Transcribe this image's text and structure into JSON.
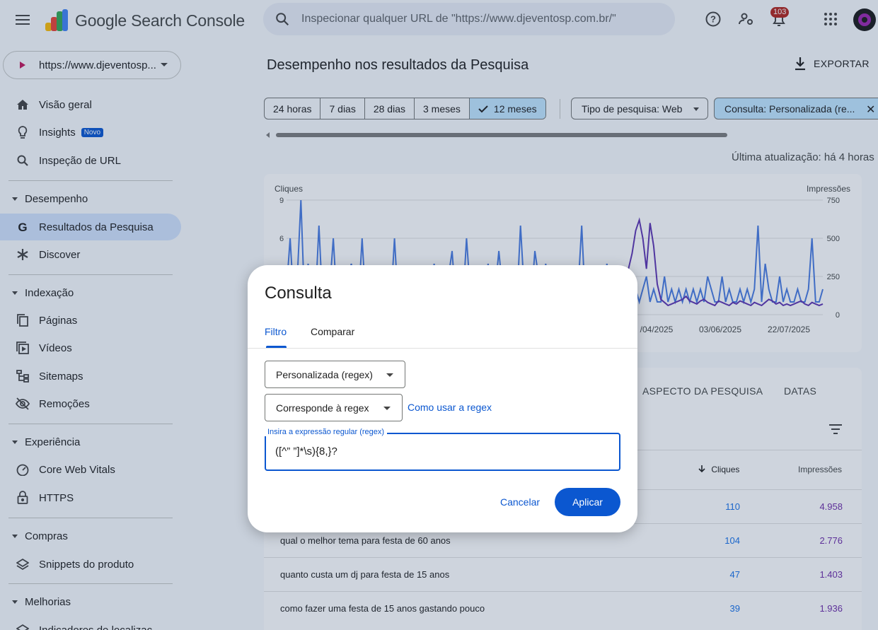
{
  "app": {
    "title": "Google Search Console"
  },
  "search": {
    "placeholder": "Inspecionar qualquer URL de \"https://www.djeventosp.com.br/\""
  },
  "header": {
    "notifications_count": "103"
  },
  "sidebar": {
    "property": "https://www.djeventosp...",
    "items": [
      {
        "label": "Visão geral"
      },
      {
        "label": "Insights",
        "badge": "Novo"
      },
      {
        "label": "Inspeção de URL"
      }
    ],
    "sections": [
      {
        "label": "Desempenho",
        "items": [
          "Resultados da Pesquisa",
          "Discover"
        ]
      },
      {
        "label": "Indexação",
        "items": [
          "Páginas",
          "Vídeos",
          "Sitemaps",
          "Remoções"
        ]
      },
      {
        "label": "Experiência",
        "items": [
          "Core Web Vitals",
          "HTTPS"
        ]
      },
      {
        "label": "Compras",
        "items": [
          "Snippets do produto"
        ]
      },
      {
        "label": "Melhorias",
        "items": [
          "Indicadores de localizac"
        ]
      }
    ]
  },
  "main": {
    "title": "Desempenho nos resultados da Pesquisa",
    "export_label": "EXPORTAR",
    "date_ranges": [
      "24 horas",
      "7 dias",
      "28 dias",
      "3 meses",
      "12 meses"
    ],
    "selected_range": "12 meses",
    "search_type_chip": "Tipo de pesquisa: Web",
    "query_chip": "Consulta: Personalizada (re...",
    "last_updated": "Última atualização: há 4 horas",
    "tabs": [
      "ASPECTO DA PESQUISA",
      "DATAS"
    ],
    "table": {
      "col_clicks": "Cliques",
      "col_impressions": "Impressões",
      "rows": [
        {
          "query": "",
          "clicks": "110",
          "impressions": "4.958"
        },
        {
          "query": "qual o melhor tema para festa de 60 anos",
          "clicks": "104",
          "impressions": "2.776"
        },
        {
          "query": "quanto custa um dj para festa de 15 anos",
          "clicks": "47",
          "impressions": "1.403"
        },
        {
          "query": "como fazer uma festa de 15 anos gastando pouco",
          "clicks": "39",
          "impressions": "1.936"
        }
      ]
    }
  },
  "chart_data": {
    "type": "line",
    "left_axis_label": "Cliques",
    "right_axis_label": "Impressões",
    "left_ticks": [
      "9",
      "6"
    ],
    "right_ticks": [
      "750",
      "500",
      "250",
      "0"
    ],
    "x_ticks": [
      "/04/2025",
      "03/06/2025",
      "22/07/2025"
    ],
    "left_ylim": [
      0,
      9
    ],
    "right_ylim": [
      0,
      750
    ],
    "series": [
      {
        "name": "Cliques",
        "color": "#4a7ce0",
        "values": [
          2,
          6,
          1,
          3,
          9,
          1,
          4,
          2,
          1,
          7,
          1,
          3,
          2,
          6,
          1,
          2,
          1,
          3,
          4,
          2,
          1,
          6,
          1,
          2,
          1,
          2,
          3,
          1,
          2,
          1,
          6,
          1,
          2,
          1,
          2,
          1,
          3,
          2,
          1,
          2,
          1,
          4,
          2,
          1,
          1,
          3,
          5,
          1,
          2,
          1,
          6,
          2,
          1,
          3,
          1,
          2,
          4,
          1,
          2,
          5,
          2,
          1,
          3,
          2,
          1,
          7,
          2,
          3,
          1,
          5,
          3,
          1,
          4,
          2,
          1,
          3,
          1,
          2,
          3,
          1,
          1,
          2,
          7,
          1,
          2,
          1,
          2,
          3,
          1,
          4,
          2,
          1,
          3,
          1,
          2,
          3,
          1,
          2,
          1,
          2,
          3,
          1,
          2,
          1,
          1,
          3,
          1,
          2,
          1,
          2,
          1,
          2,
          1,
          2,
          1,
          2,
          1,
          3,
          2,
          1,
          1,
          3,
          1,
          2,
          1,
          1,
          2,
          1,
          2,
          1,
          2,
          7,
          1,
          4,
          2,
          1,
          1,
          3,
          1,
          2,
          1,
          1,
          2,
          1,
          1,
          2,
          6,
          1,
          1,
          2
        ]
      },
      {
        "name": "Impressões",
        "color": "#5e35b1",
        "values": [
          60,
          70,
          60,
          80,
          70,
          60,
          50,
          70,
          80,
          60,
          70,
          60,
          80,
          70,
          60,
          70,
          60,
          80,
          70,
          60,
          60,
          70,
          80,
          60,
          70,
          60,
          80,
          90,
          60,
          70,
          80,
          60,
          70,
          60,
          70,
          80,
          60,
          70,
          80,
          60,
          70,
          60,
          80,
          70,
          90,
          60,
          70,
          80,
          60,
          70,
          60,
          70,
          80,
          60,
          70,
          60,
          80,
          70,
          60,
          70,
          80,
          60,
          70,
          80,
          90,
          60,
          70,
          60,
          80,
          70,
          60,
          70,
          120,
          150,
          130,
          100,
          80,
          70,
          60,
          90,
          80,
          70,
          100,
          80,
          70,
          60,
          70,
          80,
          90,
          60,
          70,
          90,
          110,
          150,
          200,
          300,
          400,
          550,
          620,
          500,
          300,
          600,
          450,
          200,
          100,
          80,
          60,
          70,
          80,
          90,
          100,
          120,
          90,
          80,
          70,
          90,
          100,
          80,
          70,
          60,
          90,
          80,
          70,
          60,
          80,
          70,
          90,
          80,
          70,
          60,
          80,
          70,
          60,
          80,
          100,
          90,
          70,
          80,
          60,
          70,
          60,
          70,
          80,
          90,
          70,
          60,
          80,
          70,
          60,
          70
        ]
      }
    ]
  },
  "dialog": {
    "title": "Consulta",
    "tabs": [
      "Filtro",
      "Comparar"
    ],
    "filter_type": "Personalizada (regex)",
    "match_type": "Corresponde à regex",
    "help_link": "Como usar a regex",
    "regex_label": "Insira a expressão regular (regex)",
    "regex_value": "([^” ”]*\\s){8,}?",
    "cancel_label": "Cancelar",
    "apply_label": "Aplicar"
  },
  "colors": {
    "accent": "#0b57d0",
    "selected_chip": "#c2e7ff",
    "clicks": "#4a7ce0",
    "impressions": "#5e35b1"
  }
}
